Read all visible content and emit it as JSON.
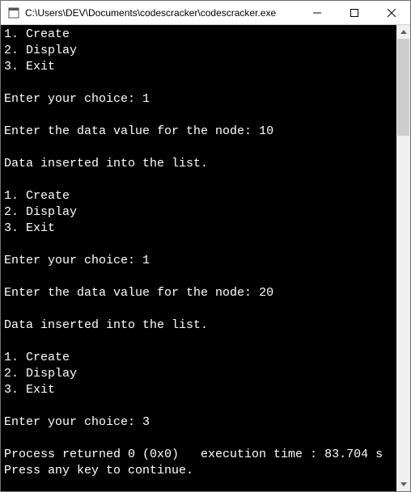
{
  "window": {
    "title": "C:\\Users\\DEV\\Documents\\codescracker\\codescracker.exe"
  },
  "console": {
    "menu": {
      "opt1": "1. Create",
      "opt2": "2. Display",
      "opt3": "3. Exit"
    },
    "prompts": {
      "choice": "Enter your choice: ",
      "data": "Enter the data value for the node: ",
      "inserted": "Data inserted into the list.",
      "process": "Process returned 0 (0x0)   execution time : 83.704 s",
      "press": "Press any key to continue."
    },
    "inputs": {
      "c1": "1",
      "d1": "10",
      "c2": "1",
      "d2": "20",
      "c3": "3"
    }
  }
}
